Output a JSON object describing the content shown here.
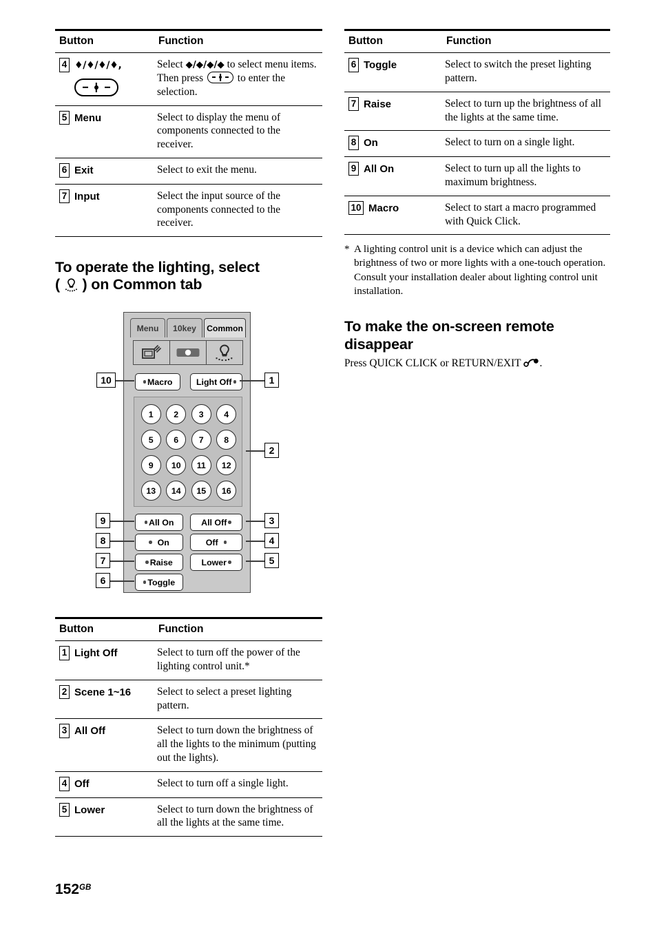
{
  "page": {
    "number": "152",
    "number_suffix": "GB"
  },
  "left_table": {
    "headers": {
      "button": "Button",
      "function": "Function"
    },
    "rows": [
      {
        "num": "4",
        "button": "♦/♦/♦/♦,",
        "button_label": "Up/Down/Left/Right, Enter",
        "function_pre": "Select ",
        "function_mid": " to select menu items. Then press ",
        "function_post": " to enter the selection."
      },
      {
        "num": "5",
        "button": "Menu",
        "function": "Select to display the menu of components connected to the receiver."
      },
      {
        "num": "6",
        "button": "Exit",
        "function": "Select to exit the menu."
      },
      {
        "num": "7",
        "button": "Input",
        "function": "Select the input source of the components connected to the receiver."
      }
    ]
  },
  "heading_lighting": {
    "line1": "To operate the lighting, select",
    "line2_pre": "(",
    "line2_post": ") on Common tab",
    "icon": "light-bulb-icon"
  },
  "remote": {
    "tabs": [
      {
        "label": "Menu",
        "active": false
      },
      {
        "label": "10key",
        "active": false
      },
      {
        "label": "Common",
        "active": true
      }
    ],
    "icon_row": [
      {
        "name": "tv-signal-icon"
      },
      {
        "name": "projector-icon"
      },
      {
        "name": "light-bulb-icon"
      }
    ],
    "top_buttons": [
      {
        "label": "Macro",
        "led": "left"
      },
      {
        "label": "Light Off",
        "led": "right"
      }
    ],
    "scene_buttons": [
      "1",
      "2",
      "3",
      "4",
      "5",
      "6",
      "7",
      "8",
      "9",
      "10",
      "11",
      "12",
      "13",
      "14",
      "15",
      "16"
    ],
    "control_buttons": [
      {
        "label": "All On",
        "led": "left"
      },
      {
        "label": "All Off",
        "led": "right"
      },
      {
        "label": "On",
        "led": "left"
      },
      {
        "label": "Off",
        "led": "right"
      },
      {
        "label": "Raise",
        "led": "left"
      },
      {
        "label": "Lower",
        "led": "right"
      },
      {
        "label": "Toggle",
        "led": "left"
      }
    ],
    "callouts": {
      "c1": "1",
      "c2": "2",
      "c3": "3",
      "c4": "4",
      "c5": "5",
      "c6": "6",
      "c7": "7",
      "c8": "8",
      "c9": "9",
      "c10": "10"
    }
  },
  "bottom_table": {
    "headers": {
      "button": "Button",
      "function": "Function"
    },
    "rows": [
      {
        "num": "1",
        "button": "Light Off",
        "function": "Select to turn off the power of the lighting control unit.*"
      },
      {
        "num": "2",
        "button": "Scene 1~16",
        "function": "Select to select a preset lighting pattern."
      },
      {
        "num": "3",
        "button": "All Off",
        "function": "Select to turn down the brightness of all the lights to the minimum (putting out the lights)."
      },
      {
        "num": "4",
        "button": "Off",
        "function": "Select to turn off a single light."
      },
      {
        "num": "5",
        "button": "Lower",
        "function": "Select to turn down the brightness of all the lights at the same time."
      }
    ]
  },
  "right_table": {
    "headers": {
      "button": "Button",
      "function": "Function"
    },
    "rows": [
      {
        "num": "6",
        "button": "Toggle",
        "function": "Select to switch the preset lighting pattern."
      },
      {
        "num": "7",
        "button": "Raise",
        "function": "Select to turn up the brightness of all the lights at the same time."
      },
      {
        "num": "8",
        "button": "On",
        "function": "Select to turn on a single light."
      },
      {
        "num": "9",
        "button": "All On",
        "function": "Select to turn up all the lights to maximum brightness."
      },
      {
        "num": "10",
        "button": "Macro",
        "function": "Select to start a macro programmed with Quick Click."
      }
    ]
  },
  "footnote": {
    "marker": "*",
    "line1": "A lighting control unit is a device which can adjust the brightness of two or more lights with a one-touch operation.",
    "line2": "Consult your installation dealer about lighting control unit installation."
  },
  "heading_disappear": {
    "line1": "To make the on-screen remote",
    "line2": "disappear",
    "body_pre": "Press QUICK CLICK or RETURN/EXIT",
    "body_post": ".",
    "icon": "return-exit-icon"
  }
}
